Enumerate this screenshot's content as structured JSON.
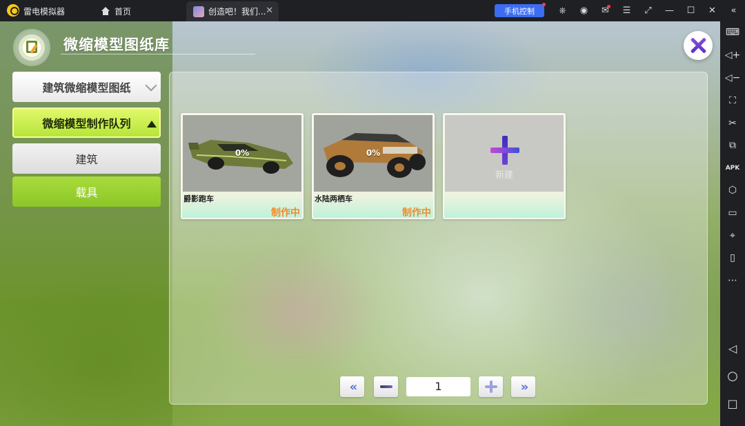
{
  "titlebar": {
    "app_name": "雷电模拟器",
    "home_label": "首页",
    "tab_label": "创造吧！我们...",
    "tab_close": "✕",
    "phone_control": "手机控制",
    "icons": [
      "gamepad-icon",
      "user-icon",
      "mail-icon",
      "menu-icon",
      "restore-icon",
      "minimize-icon",
      "maximize-icon",
      "close-icon",
      "collapse-icon"
    ],
    "icon_glyphs": [
      "⎈",
      "◉",
      "✉",
      "☰",
      "⤢",
      "—",
      "☐",
      "✕",
      "«"
    ]
  },
  "sidebar": {
    "icons": [
      "keyboard-icon",
      "volume-up-icon",
      "volume-down-icon",
      "screenshot-icon",
      "scissors-icon",
      "multi-window-icon",
      "apk-icon",
      "settings-icon",
      "folder-icon",
      "location-icon",
      "shake-icon",
      "more-icon",
      "back-icon",
      "home-circle-icon",
      "recent-apps-icon"
    ],
    "glyphs": [
      "⌨",
      "◁+",
      "◁−",
      "⛶",
      "✂",
      "⧉",
      "APK",
      "⬡",
      "▭",
      "⌖",
      "▯",
      "⋯",
      "◁",
      "○",
      "□"
    ]
  },
  "game": {
    "title": "微缩模型图纸库",
    "menu": {
      "building_blueprints": "建筑微缩模型图纸",
      "production_queue": "微缩模型制作队列",
      "building": "建筑",
      "vehicle": "载具"
    },
    "cards": [
      {
        "name": "爵影跑车",
        "progress": "0%",
        "status": "制作中"
      },
      {
        "name": "水陆两栖车",
        "progress": "0%",
        "status": "制作中"
      }
    ],
    "new_card_label": "新建",
    "pagination": {
      "current_page": "1"
    },
    "colors": {
      "accent_green": "#b6e53a",
      "status_orange": "#f08a2a",
      "close_purple": "#6a38cf"
    }
  }
}
